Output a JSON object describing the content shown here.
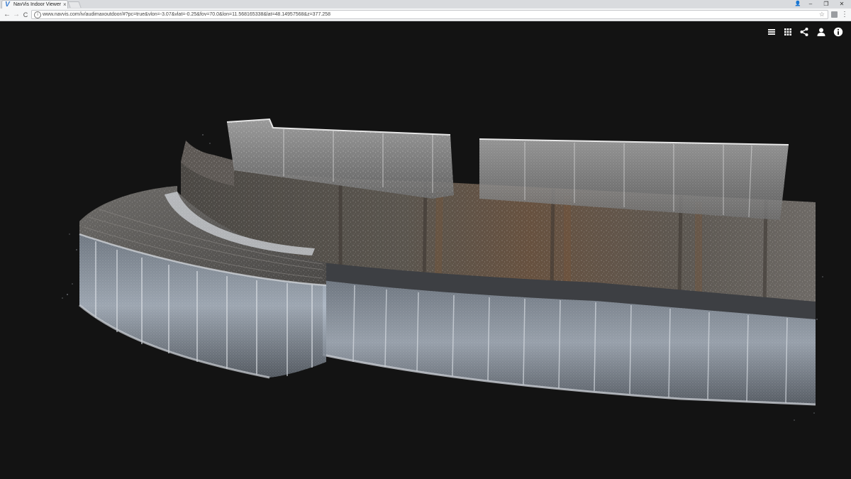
{
  "browser": {
    "tab_logo": "V",
    "tab_title": "NavVis Indoor Viewer",
    "tab_close": "×",
    "window_buttons": [
      "👤",
      "–",
      "❐",
      "✕"
    ],
    "back": "←",
    "forward": "→",
    "reload": "C",
    "info": "i",
    "url": "www.navvis.com/iv/audimaxoutdoor/#?pc=true&vlon=-3.07&vlat=-0.25&fov=70.0&lon=11.568165338&lat=48.14957568&z=377.258",
    "star": "☆",
    "menu": "⋮"
  },
  "viewer": {
    "toolbar_icons": [
      "list-icon",
      "grid-icon",
      "share-icon",
      "user-icon",
      "info-icon"
    ],
    "background_color": "#131313",
    "scene_description_colors": {
      "concrete": "#5a5650",
      "glass": "#a8b4c2",
      "rust": "#6a4a34"
    }
  }
}
